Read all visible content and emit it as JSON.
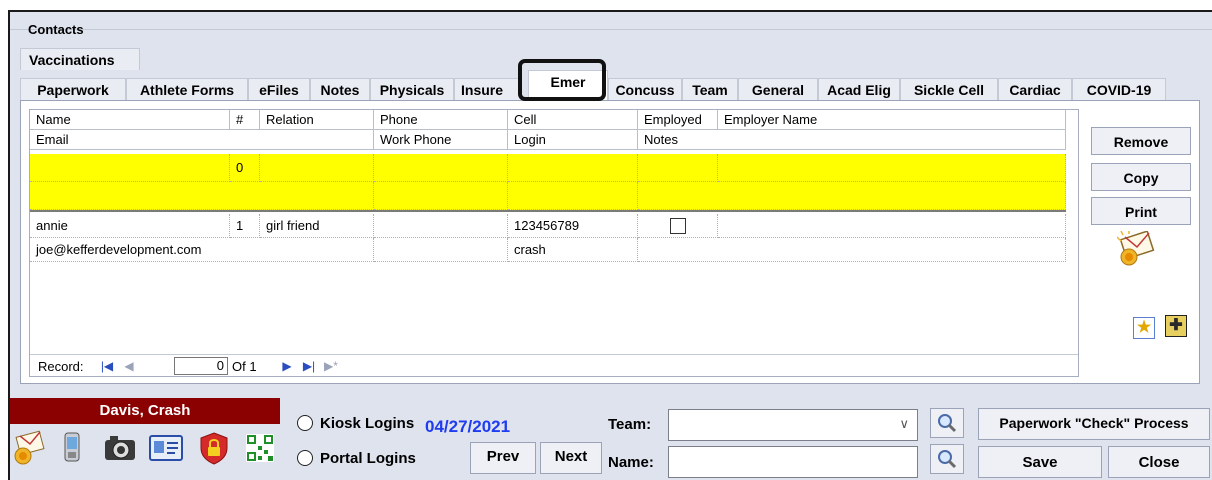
{
  "group": {
    "legend": "Contacts"
  },
  "vaccinations_tab": "Vaccinations",
  "tabs": [
    {
      "label": "Paperwork"
    },
    {
      "label": "Athlete Forms"
    },
    {
      "label": "eFiles"
    },
    {
      "label": "Notes"
    },
    {
      "label": "Physicals"
    },
    {
      "label": "Insure"
    },
    {
      "label": "Emer",
      "active": true
    },
    {
      "label": "Concuss"
    },
    {
      "label": "Team"
    },
    {
      "label": "General"
    },
    {
      "label": "Acad Elig"
    },
    {
      "label": "Sickle Cell"
    },
    {
      "label": "Cardiac"
    },
    {
      "label": "COVID-19"
    }
  ],
  "grid": {
    "header_row1": [
      "Name",
      "#",
      "Relation",
      "Phone",
      "Cell",
      "Employed",
      "Employer Name"
    ],
    "header_row2": [
      "Email",
      "Work Phone",
      "Login",
      "Notes"
    ],
    "new_row": {
      "number": "0"
    },
    "records": [
      {
        "name": "annie",
        "number": "1",
        "relation": "girl friend",
        "phone": "",
        "cell": "123456789",
        "employed": false,
        "employer": "",
        "email": "joe@kefferdevelopment.com",
        "work_phone": "",
        "login": "crash",
        "notes": ""
      }
    ]
  },
  "record_nav": {
    "label": "Record:",
    "current": "0",
    "of_text": "Of  1"
  },
  "side_buttons": {
    "remove": "Remove",
    "copy": "Copy",
    "print": "Print"
  },
  "side_icons": [
    "star-icon",
    "plus-icon"
  ],
  "athlete": {
    "name": "Davis, Crash"
  },
  "bottom_icons": [
    "envelope-seal-icon",
    "phone-icon",
    "camera-icon",
    "id-card-icon",
    "lock-shield-icon",
    "qr-code-icon"
  ],
  "options": {
    "kiosk": "Kiosk Logins",
    "portal": "Portal Logins"
  },
  "date": "04/27/2021",
  "nav": {
    "prev": "Prev",
    "next": "Next"
  },
  "filters": {
    "team_label": "Team:",
    "team_value": "",
    "name_label": "Name:",
    "name_value": ""
  },
  "actions": {
    "paperwork_check": "Paperwork \"Check\" Process",
    "save": "Save",
    "close": "Close"
  },
  "colors": {
    "name_banner": "#8b0000",
    "date": "#1e3cf0",
    "highlight_row": "#ffff00"
  }
}
